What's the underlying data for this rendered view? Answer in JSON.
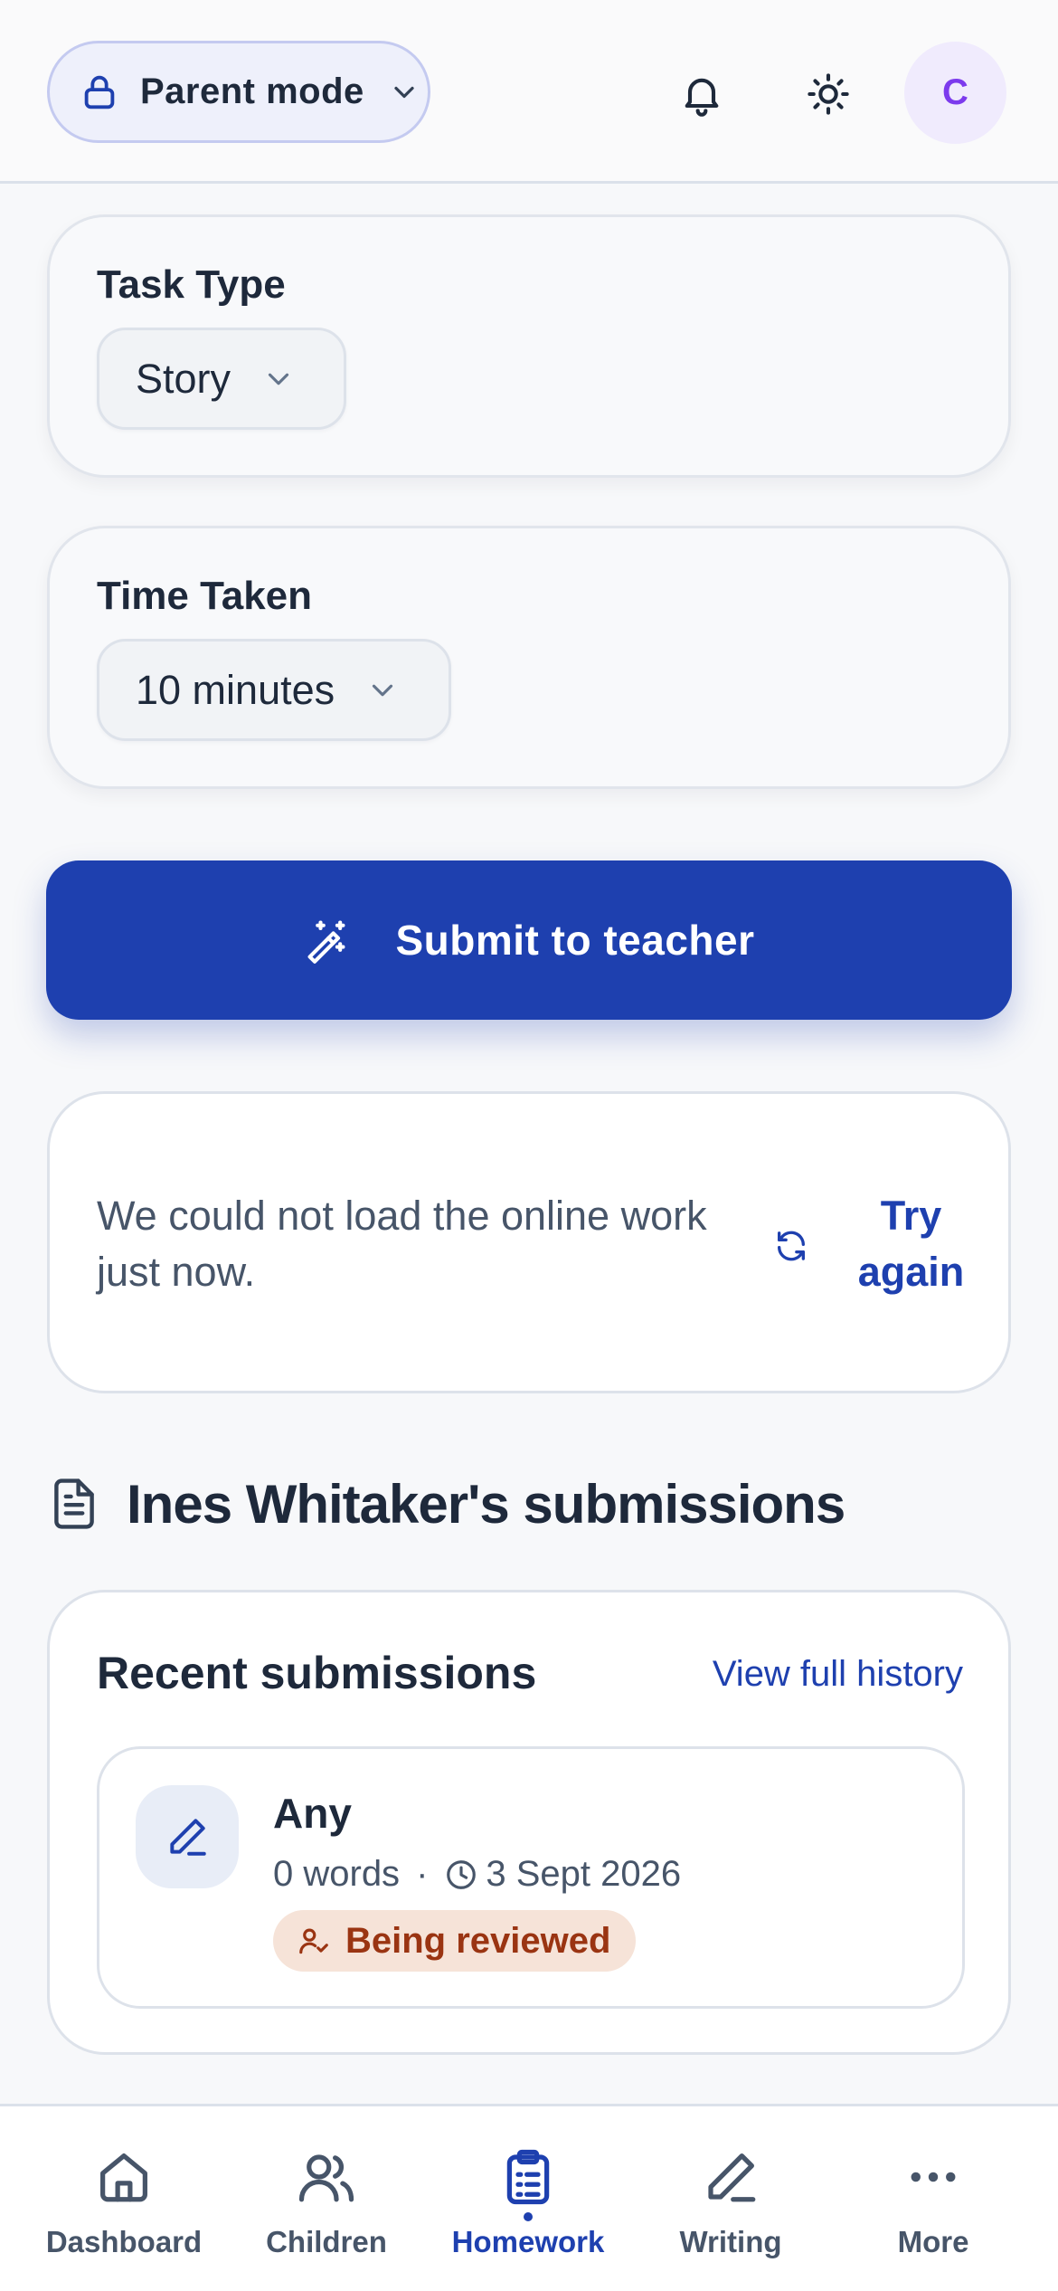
{
  "header": {
    "mode_label": "Parent mode",
    "avatar_initial": "C"
  },
  "task_type": {
    "title": "Task Type",
    "value": "Story"
  },
  "time_taken": {
    "title": "Time Taken",
    "value": "10 minutes"
  },
  "submit": {
    "label": "Submit to teacher"
  },
  "error": {
    "message": "We could not load the online work just now.",
    "retry_label": "Try again"
  },
  "submissions": {
    "section_title": "Ines Whitaker's submissions",
    "card_title": "Recent submissions",
    "history_link": "View full history",
    "items": [
      {
        "name": "Any",
        "words": "0 words",
        "separator": "·",
        "date": "3 Sept 2026",
        "status": "Being reviewed"
      }
    ]
  },
  "nav": {
    "items": [
      {
        "label": "Dashboard",
        "icon": "home-icon"
      },
      {
        "label": "Children",
        "icon": "users-icon"
      },
      {
        "label": "Homework",
        "icon": "clipboard-icon"
      },
      {
        "label": "Writing",
        "icon": "pen-icon"
      },
      {
        "label": "More",
        "icon": "more-icon"
      }
    ],
    "active": "Homework"
  },
  "colors": {
    "primary": "#1e40af",
    "avatar_text": "#7c3aed",
    "badge_bg": "#f6e3d8",
    "badge_text": "#9a3412"
  }
}
